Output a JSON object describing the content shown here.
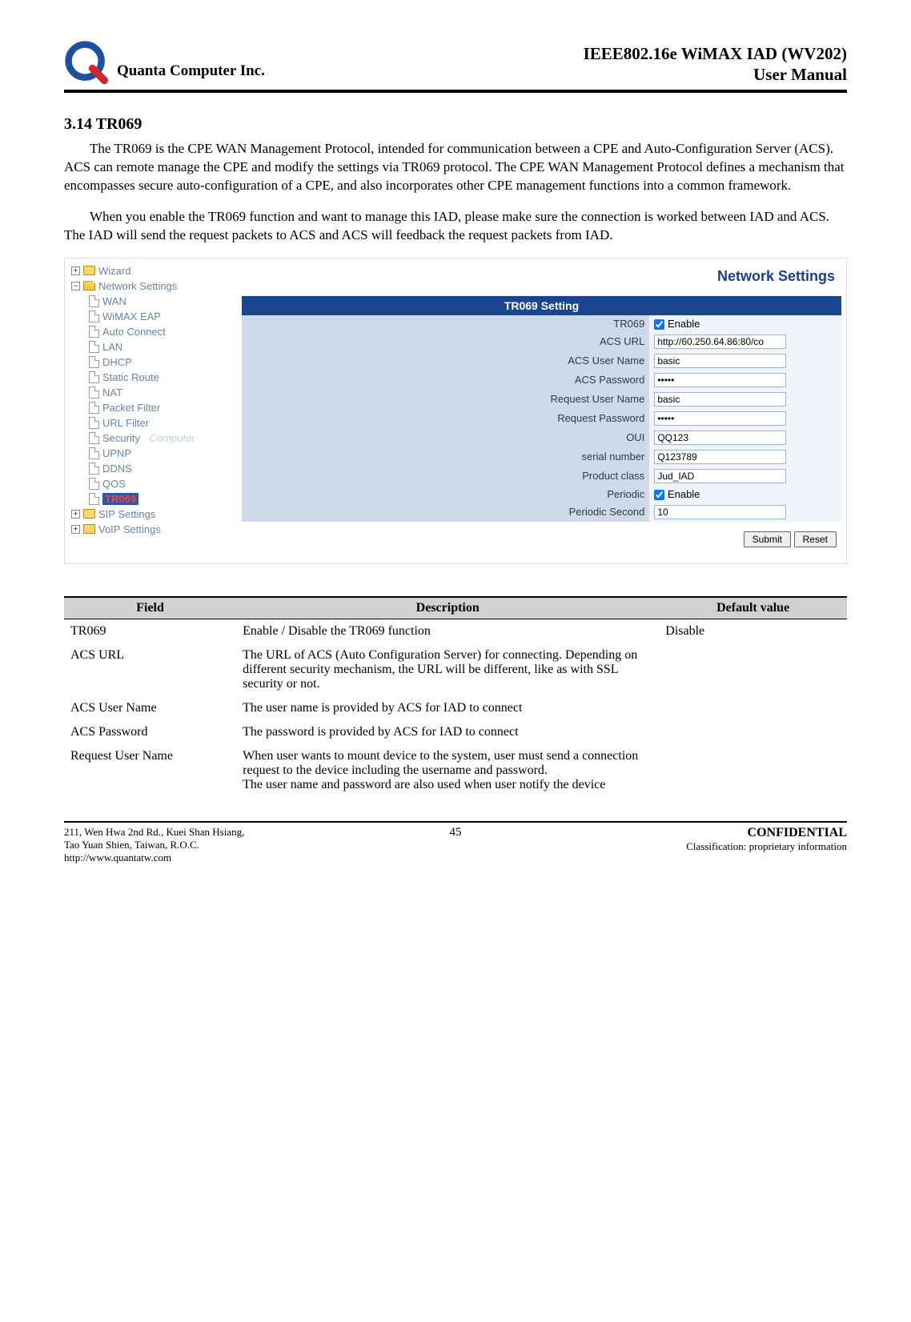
{
  "header": {
    "company": "Quanta  Computer  Inc.",
    "title_line1": "IEEE802.16e  WiMAX  IAD  (WV202)",
    "title_line2": "User  Manual"
  },
  "section": {
    "heading": "3.14 TR069",
    "para1": "The TR069 is the CPE WAN Management Protocol, intended for communication between a CPE and Auto-Configuration Server (ACS). ACS can remote manage the CPE and modify the settings via TR069 protocol. The CPE WAN Management Protocol defines a mechanism that encompasses secure auto-configuration of a CPE, and also incorporates other CPE management functions into a common framework.",
    "para2": "When you enable the TR069 function and want to manage this IAD, please make sure the connection is worked between IAD and ACS. The IAD will send the request packets to ACS and ACS will feedback the request packets from IAD."
  },
  "tree": {
    "wizard": "Wizard",
    "network_settings": "Network Settings",
    "items": [
      {
        "label": "WAN"
      },
      {
        "label": "WiMAX EAP"
      },
      {
        "label": "Auto Connect"
      },
      {
        "label": "LAN"
      },
      {
        "label": "DHCP"
      },
      {
        "label": "Static Route"
      },
      {
        "label": "NAT"
      },
      {
        "label": "Packet Filter"
      },
      {
        "label": "URL Filter"
      },
      {
        "label": "Security"
      },
      {
        "label": "UPNP"
      },
      {
        "label": "DDNS"
      },
      {
        "label": "QOS"
      },
      {
        "label": "TR069"
      }
    ],
    "watermark": "Computer",
    "sip_settings": "SIP Settings",
    "voip_settings": "VoIP Settings"
  },
  "settings": {
    "panel_title": "Network Settings",
    "table_header": "TR069 Setting",
    "rows": {
      "tr069_label": "TR069",
      "tr069_enable": "Enable",
      "acs_url_label": "ACS URL",
      "acs_url_value": "http://60.250.64.86:80/co",
      "acs_user_label": "ACS User Name",
      "acs_user_value": "basic",
      "acs_pw_label": "ACS Password",
      "acs_pw_value": "•••••",
      "req_user_label": "Request User Name",
      "req_user_value": "basic",
      "req_pw_label": "Request Password",
      "req_pw_value": "•••••",
      "oui_label": "OUI",
      "oui_value": "QQ123",
      "serial_label": "serial number",
      "serial_value": "Q123789",
      "pclass_label": "Product class",
      "pclass_value": "Jud_IAD",
      "periodic_label": "Periodic",
      "periodic_enable": "Enable",
      "psec_label": "Periodic Second",
      "psec_value": "10"
    },
    "submit": "Submit",
    "reset": "Reset"
  },
  "desc_table": {
    "head_field": "Field",
    "head_desc": "Description",
    "head_default": "Default value",
    "rows": [
      {
        "field": "TR069",
        "desc": "Enable / Disable the TR069 function",
        "def": "Disable"
      },
      {
        "field": "ACS URL",
        "desc": "The URL of ACS (Auto Configuration Server) for connecting. Depending on different security mechanism, the URL will be different, like as with SSL security or not.",
        "def": ""
      },
      {
        "field": "ACS User Name",
        "desc": "The user name is provided by ACS for IAD to connect",
        "def": ""
      },
      {
        "field": "ACS Password",
        "desc": "The password is provided by ACS for IAD to connect",
        "def": ""
      },
      {
        "field": "Request User Name",
        "desc": "When user wants to mount device to the system, user must send a connection request to the device including the username and password.\nThe user name and password are also used when user notify the device",
        "def": ""
      }
    ]
  },
  "footer": {
    "addr1": "211, Wen Hwa 2nd Rd., Kuei Shan Hsiang,",
    "addr2": "Tao Yuan Shien, Taiwan, R.O.C.",
    "url": "http://www.quantatw.com",
    "page": "45",
    "conf": "CONFIDENTIAL",
    "class": "Classification: proprietary information"
  }
}
